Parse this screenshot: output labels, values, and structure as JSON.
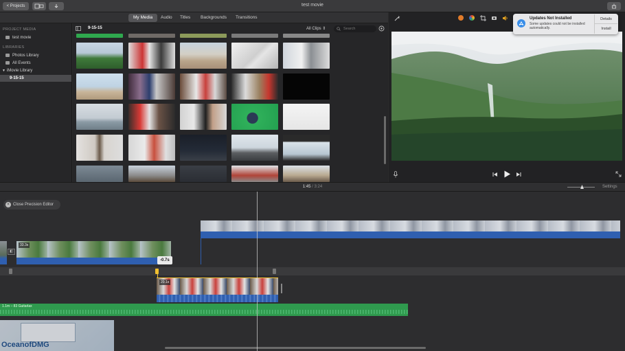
{
  "titlebar": {
    "projects_label": "< Projects",
    "title": "test movie"
  },
  "tabs": [
    {
      "label": "My Media",
      "active": true
    },
    {
      "label": "Audio",
      "active": false
    },
    {
      "label": "Titles",
      "active": false
    },
    {
      "label": "Backgrounds",
      "active": false
    },
    {
      "label": "Transitions",
      "active": false
    }
  ],
  "sidebar": {
    "project_media_heading": "PROJECT MEDIA",
    "project_item": "test movie",
    "libraries_heading": "LIBRARIES",
    "items": [
      {
        "label": "Photos Library",
        "icon": "photos-icon"
      },
      {
        "label": "All Events",
        "icon": "events-icon"
      },
      {
        "label": "iMovie Library",
        "icon": "disclosure-triangle-icon"
      },
      {
        "label": "9-15-15",
        "icon": "",
        "selected": true
      }
    ]
  },
  "browser": {
    "event_title": "9-15-15",
    "clips_filter": "All Clips",
    "search_placeholder": "Search"
  },
  "notification": {
    "title": "Updates Not Installed",
    "body": "Some updates could not be installed automatically.",
    "details_label": "Details",
    "install_label": "Install"
  },
  "timebar": {
    "current_time": "1:45",
    "separator": "/",
    "total_time": "3:24",
    "settings_label": "Settings"
  },
  "timeline": {
    "precision_editor_label": "Close Precision Editor",
    "clip1_duration": "33.3s",
    "offset_label": "-0.7s",
    "clip2_duration": "20.1s",
    "audio_label": "1.1m – 83 Guitarlax"
  },
  "watermark": "OceanofDMG",
  "colors": {
    "accent_blue": "#2f5fb0",
    "audio_green": "#2f9a4e",
    "selection_yellow": "#f0c030",
    "notification_blue": "#3a8ee8"
  }
}
